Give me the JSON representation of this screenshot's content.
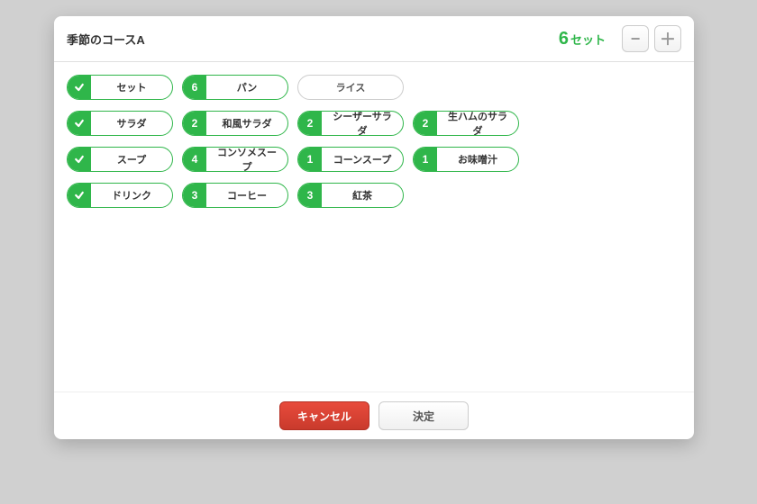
{
  "header": {
    "title": "季節のコースA",
    "count": "6",
    "suffix": "セット",
    "minus": "−",
    "plus": "＋"
  },
  "rows": [
    {
      "cat": "セット",
      "items": [
        {
          "badge": "6",
          "label": "パン",
          "sel": true
        },
        {
          "badge": "",
          "label": "ライス",
          "sel": false
        }
      ]
    },
    {
      "cat": "サラダ",
      "items": [
        {
          "badge": "2",
          "label": "和風サラダ",
          "sel": true
        },
        {
          "badge": "2",
          "label": "シーザーサラダ",
          "sel": true
        },
        {
          "badge": "2",
          "label": "生ハムのサラダ",
          "sel": true
        }
      ]
    },
    {
      "cat": "スープ",
      "items": [
        {
          "badge": "4",
          "label": "コンソメスープ",
          "sel": true
        },
        {
          "badge": "1",
          "label": "コーンスープ",
          "sel": true
        },
        {
          "badge": "1",
          "label": "お味噌汁",
          "sel": true
        }
      ]
    },
    {
      "cat": "ドリンク",
      "items": [
        {
          "badge": "3",
          "label": "コーヒー",
          "sel": true
        },
        {
          "badge": "3",
          "label": "紅茶",
          "sel": true
        }
      ]
    }
  ],
  "footer": {
    "cancel": "キャンセル",
    "ok": "決定"
  }
}
